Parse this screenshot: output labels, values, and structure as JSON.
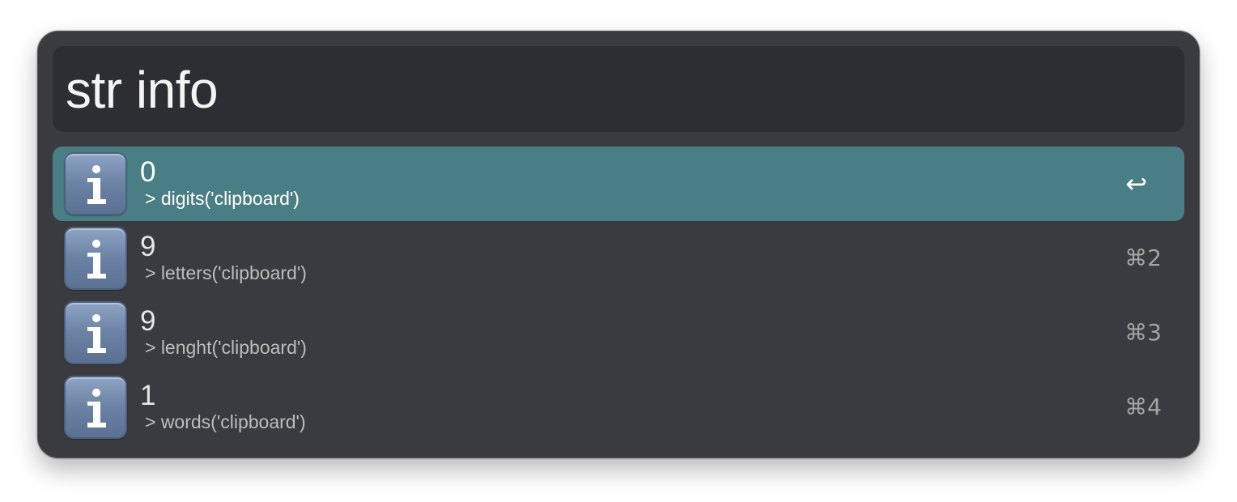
{
  "search": {
    "query": "str info"
  },
  "results": [
    {
      "title": "0",
      "subtitle": "> digits('clipboard')",
      "shortcut": "↩",
      "icon": "info-icon",
      "selected": true
    },
    {
      "title": "9",
      "subtitle": "> letters('clipboard')",
      "shortcut": "⌘2",
      "icon": "info-icon",
      "selected": false
    },
    {
      "title": "9",
      "subtitle": "> lenght('clipboard')",
      "shortcut": "⌘3",
      "icon": "info-icon",
      "selected": false
    },
    {
      "title": "1",
      "subtitle": "> words('clipboard')",
      "shortcut": "⌘4",
      "icon": "info-icon",
      "selected": false
    }
  ],
  "colors": {
    "window_background": "#3a3b3f",
    "search_background": "#2d2e31",
    "selection": "#4a7e85",
    "icon_blue": "#6c82a4"
  }
}
